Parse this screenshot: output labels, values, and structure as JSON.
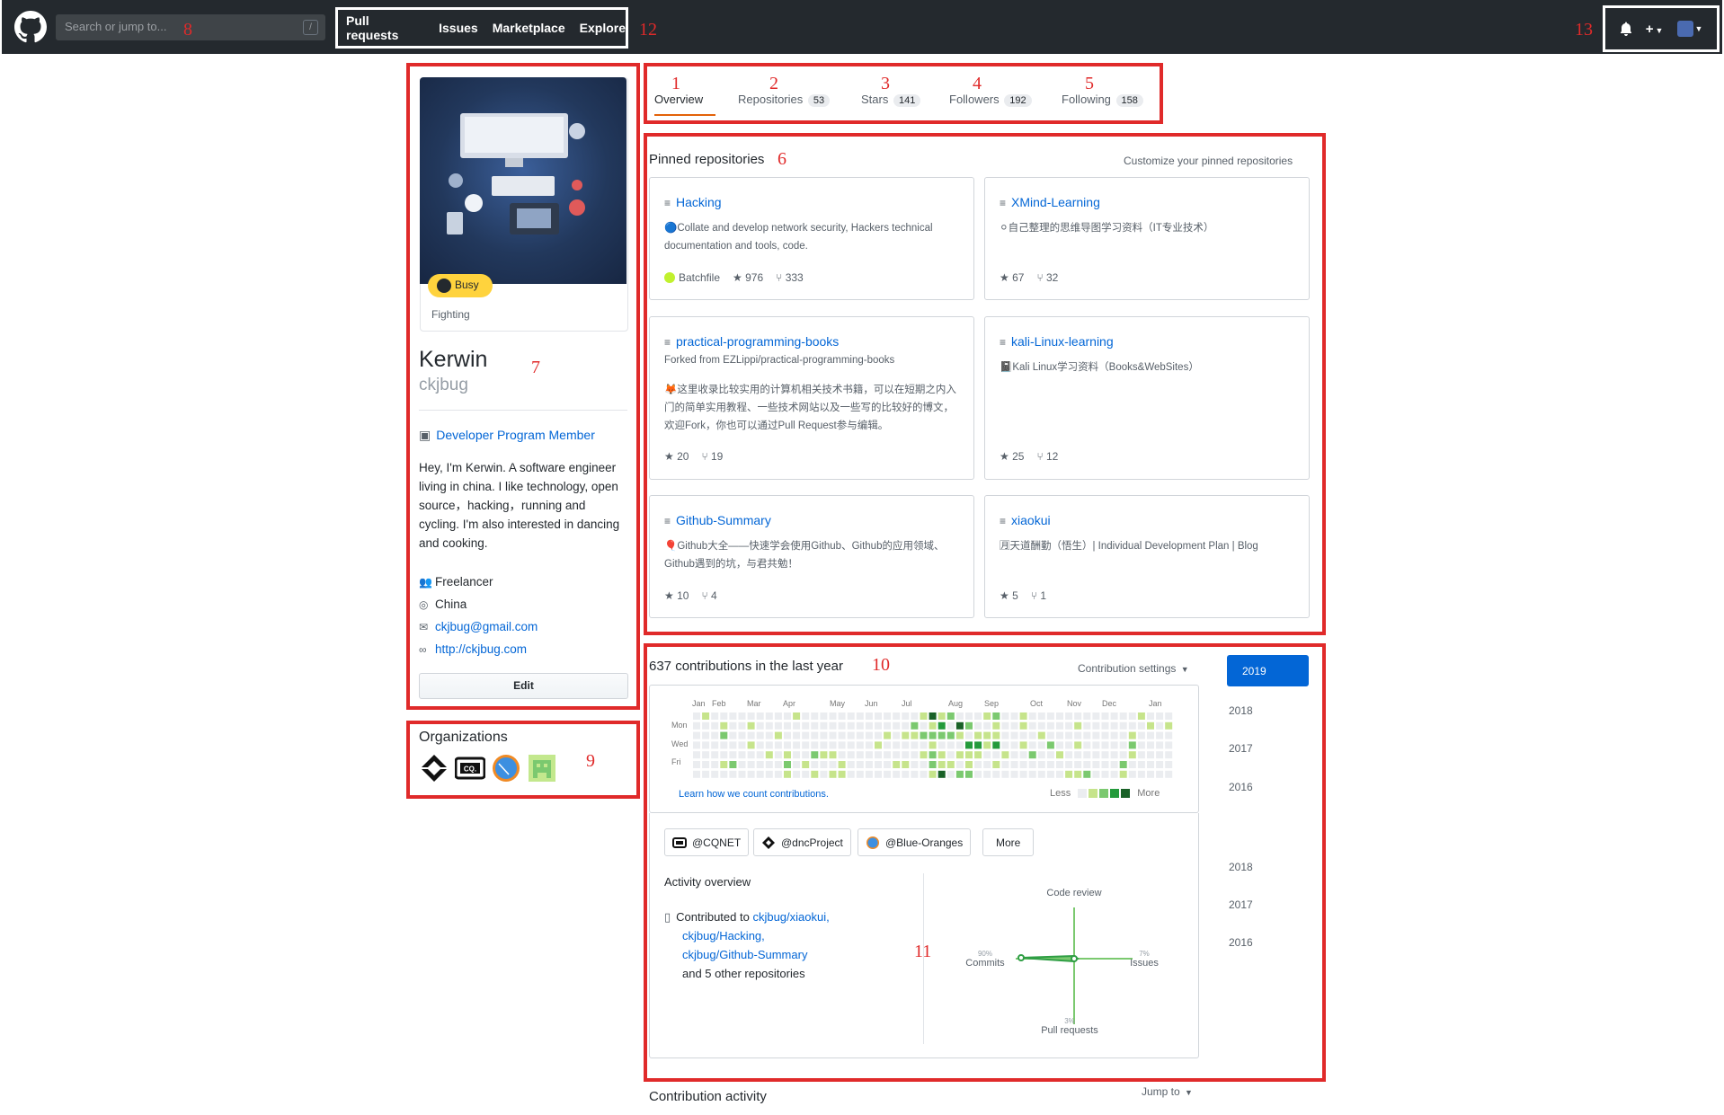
{
  "header": {
    "search_placeholder": "Search or jump to...",
    "search_shortcut": "/",
    "nav": [
      "Pull requests",
      "Issues",
      "Marketplace",
      "Explore"
    ],
    "plus_label": "+"
  },
  "annotations": [
    "1",
    "2",
    "3",
    "4",
    "5",
    "6",
    "7",
    "8",
    "9",
    "10",
    "11",
    "12",
    "13"
  ],
  "profile": {
    "status_label": "Busy",
    "status_message": "Fighting",
    "fullname": "Kerwin",
    "username": "ckjbug",
    "badge": "Developer Program Member",
    "bio": "Hey, I'm Kerwin. A software engineer living in china. I like technology, open source，hacking，running and cycling. I'm also interested in dancing and cooking.",
    "company": "Freelancer",
    "location": "China",
    "email": "ckjbug@gmail.com",
    "website": "http://ckjbug.com",
    "edit_label": "Edit",
    "organizations_title": "Organizations"
  },
  "tabs": [
    {
      "label": "Overview",
      "count": ""
    },
    {
      "label": "Repositories",
      "count": "53"
    },
    {
      "label": "Stars",
      "count": "141"
    },
    {
      "label": "Followers",
      "count": "192"
    },
    {
      "label": "Following",
      "count": "158"
    }
  ],
  "pinned": {
    "title": "Pinned repositories",
    "customize": "Customize your pinned repositories",
    "repos": [
      {
        "name": "Hacking",
        "forked": "",
        "desc": "🔵Collate and develop network security, Hackers technical documentation and tools, code.",
        "lang": "Batchfile",
        "stars": "976",
        "forks": "333"
      },
      {
        "name": "XMind-Learning",
        "forked": "",
        "desc": "⚪自己整理的思维导图学习资料（IT专业技术）",
        "lang": "",
        "stars": "67",
        "forks": "32"
      },
      {
        "name": "practical-programming-books",
        "forked": "Forked from EZLippi/practical-programming-books",
        "desc": "🦊这里收录比较实用的计算机相关技术书籍，可以在短期之内入门的简单实用教程、一些技术网站以及一些写的比较好的博文，欢迎Fork，你也可以通过Pull Request参与编辑。",
        "lang": "",
        "stars": "20",
        "forks": "19"
      },
      {
        "name": "kali-Linux-learning",
        "forked": "",
        "desc": "📓Kali Linux学习资料（Books&WebSites）",
        "lang": "",
        "stars": "25",
        "forks": "12"
      },
      {
        "name": "Github-Summary",
        "forked": "",
        "desc": "🎈Github大全——快速学会使用Github、Github的应用领域、Github遇到的坑，与君共勉！",
        "lang": "",
        "stars": "10",
        "forks": "4"
      },
      {
        "name": "xiaokui",
        "forked": "",
        "desc": "🈷天道酬勤（悟生）| Individual Development Plan | Blog",
        "lang": "",
        "stars": "5",
        "forks": "1"
      }
    ]
  },
  "contributions": {
    "title": "637 contributions in the last year",
    "settings": "Contribution settings",
    "months": [
      "Jan",
      "Feb",
      "Mar",
      "Apr",
      "May",
      "Jun",
      "Jul",
      "Aug",
      "Sep",
      "Oct",
      "Nov",
      "Dec",
      "Jan"
    ],
    "days": [
      "Mon",
      "Wed",
      "Fri"
    ],
    "learn": "Learn how we count contributions.",
    "less": "Less",
    "more": "More",
    "colors": [
      "#ebedf0",
      "#c6e48b",
      "#7bc96f",
      "#239a3b",
      "#196127"
    ],
    "years": [
      "2019",
      "2018",
      "2017",
      "2016",
      "2018",
      "2017",
      "2016"
    ]
  },
  "activity": {
    "org_filters": [
      "@CQNET",
      "@dncProject",
      "@Blue-Oranges"
    ],
    "more_label": "More",
    "overview_title": "Activity overview",
    "contributed_prefix": "Contributed to",
    "repos": [
      "ckjbug/xiaokui,",
      "ckjbug/Hacking,",
      "ckjbug/Github-Summary"
    ],
    "others": "and 5 other repositories",
    "radar": {
      "code_review": {
        "label": "Code review",
        "pct": ""
      },
      "commits": {
        "label": "Commits",
        "pct": "90%"
      },
      "issues": {
        "label": "Issues",
        "pct": "7%"
      },
      "pull_requests": {
        "label": "Pull requests",
        "pct": "3%"
      }
    }
  },
  "footer": {
    "contrib_activity": "Contribution activity",
    "jump_to": "Jump to"
  }
}
